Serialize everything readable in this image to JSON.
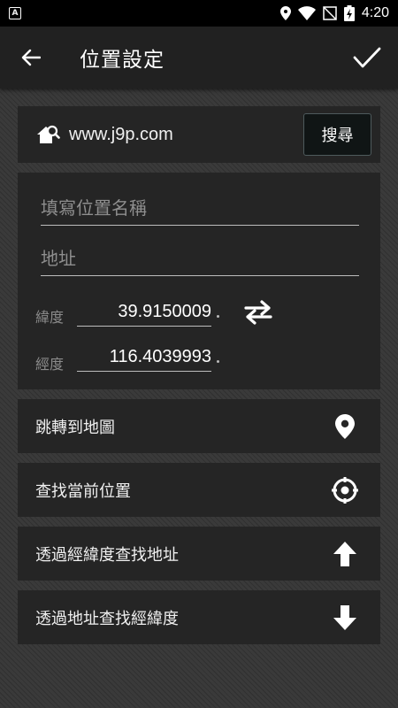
{
  "status_bar": {
    "notification_icon": "app-notification-icon",
    "time": "4:20"
  },
  "app_bar": {
    "title": "位置設定",
    "back_icon": "arrow-left-icon",
    "confirm_icon": "checkmark-icon"
  },
  "search": {
    "site": "www.j9p.com",
    "button_label": "搜尋"
  },
  "form": {
    "name_placeholder": "填寫位置名稱",
    "address_placeholder": "地址",
    "latitude_label": "緯度",
    "latitude_value": "39.9150009",
    "longitude_label": "經度",
    "longitude_value": "116.4039993"
  },
  "actions": [
    {
      "label": "跳轉到地圖",
      "icon": "map-pin-icon"
    },
    {
      "label": "查找當前位置",
      "icon": "crosshair-icon"
    },
    {
      "label": "透過經緯度查找地址",
      "icon": "arrow-up-icon"
    },
    {
      "label": "透過地址查找經緯度",
      "icon": "arrow-down-icon"
    }
  ]
}
